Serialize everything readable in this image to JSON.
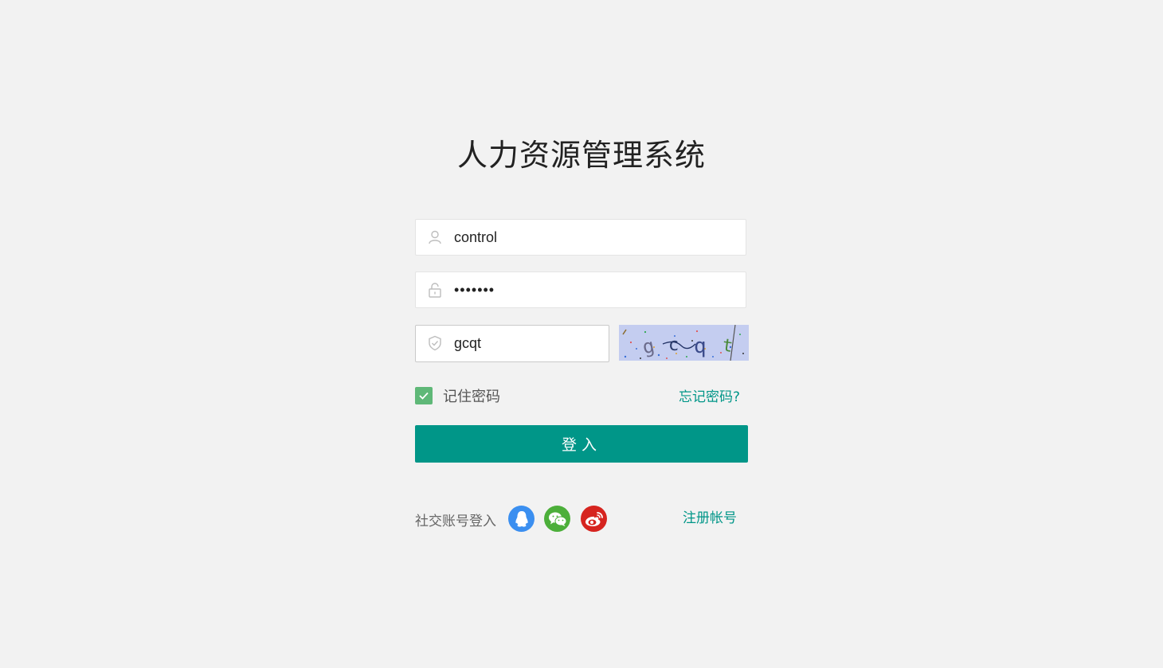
{
  "app": {
    "title": "人力资源管理系统"
  },
  "form": {
    "username": {
      "value": "control",
      "icon": "user-icon"
    },
    "password": {
      "value": "•••••••",
      "icon": "lock-icon"
    },
    "captcha": {
      "value": "gcqt",
      "icon": "shield-check-icon",
      "image_text": "gcqt"
    },
    "remember": {
      "label": "记住密码",
      "checked": true
    },
    "forgot_label": "忘记密码?",
    "login_label": "登入"
  },
  "social": {
    "label": "社交账号登入",
    "providers": [
      {
        "name": "QQ",
        "icon": "qq-icon",
        "color": "#3b8ff0"
      },
      {
        "name": "WeChat",
        "icon": "wechat-icon",
        "color": "#4caf3a"
      },
      {
        "name": "Weibo",
        "icon": "weibo-icon",
        "color": "#d6241f"
      }
    ],
    "register_label": "注册帐号"
  },
  "colors": {
    "accent": "#009688",
    "checkbox": "#5fb878",
    "background": "#f2f2f2",
    "captcha_bg": "#c4cdf0"
  }
}
